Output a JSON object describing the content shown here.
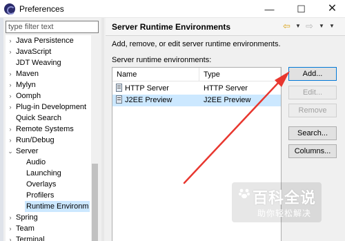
{
  "window": {
    "title": "Preferences",
    "minimize_glyph": "—",
    "maximize_glyph": "☐",
    "close_glyph": "✕"
  },
  "sidebar": {
    "filter_placeholder": "type filter text",
    "items": [
      {
        "label": "Java Persistence",
        "arrow": "›",
        "level": 0
      },
      {
        "label": "JavaScript",
        "arrow": "›",
        "level": 0
      },
      {
        "label": "JDT Weaving",
        "arrow": "",
        "level": 0
      },
      {
        "label": "Maven",
        "arrow": "›",
        "level": 0
      },
      {
        "label": "Mylyn",
        "arrow": "›",
        "level": 0
      },
      {
        "label": "Oomph",
        "arrow": "›",
        "level": 0
      },
      {
        "label": "Plug-in Development",
        "arrow": "›",
        "level": 0
      },
      {
        "label": "Quick Search",
        "arrow": "",
        "level": 0
      },
      {
        "label": "Remote Systems",
        "arrow": "›",
        "level": 0
      },
      {
        "label": "Run/Debug",
        "arrow": "›",
        "level": 0
      },
      {
        "label": "Server",
        "arrow": "⌄",
        "level": 0
      },
      {
        "label": "Audio",
        "arrow": "",
        "level": 1
      },
      {
        "label": "Launching",
        "arrow": "",
        "level": 1
      },
      {
        "label": "Overlays",
        "arrow": "",
        "level": 1
      },
      {
        "label": "Profilers",
        "arrow": "",
        "level": 1
      },
      {
        "label": "Runtime Environm",
        "arrow": "",
        "level": 1,
        "selected": true
      },
      {
        "label": "Spring",
        "arrow": "›",
        "level": 0
      },
      {
        "label": "Team",
        "arrow": "›",
        "level": 0
      },
      {
        "label": "Terminal",
        "arrow": "›",
        "level": 0
      }
    ]
  },
  "page": {
    "title": "Server Runtime Environments",
    "description": "Add, remove, or edit server runtime environments.",
    "list_label": "Server runtime environments:",
    "nav_back_glyph": "⇦",
    "nav_fwd_glyph": "⇨",
    "dropdown_glyph": "▼"
  },
  "table": {
    "columns": [
      "Name",
      "Type"
    ],
    "rows": [
      {
        "name": "HTTP Server",
        "type": "HTTP Server",
        "selected": false
      },
      {
        "name": "J2EE Preview",
        "type": "J2EE Preview",
        "selected": true
      }
    ]
  },
  "buttons": {
    "add": "Add...",
    "edit": "Edit...",
    "remove": "Remove",
    "search": "Search...",
    "columns": "Columns..."
  },
  "watermark": {
    "title": "百科全说",
    "subtitle": "助你轻松解决"
  },
  "colors": {
    "selection": "#cce8ff",
    "arrow": "#e8372f",
    "nav_back": "#d9a31a"
  }
}
